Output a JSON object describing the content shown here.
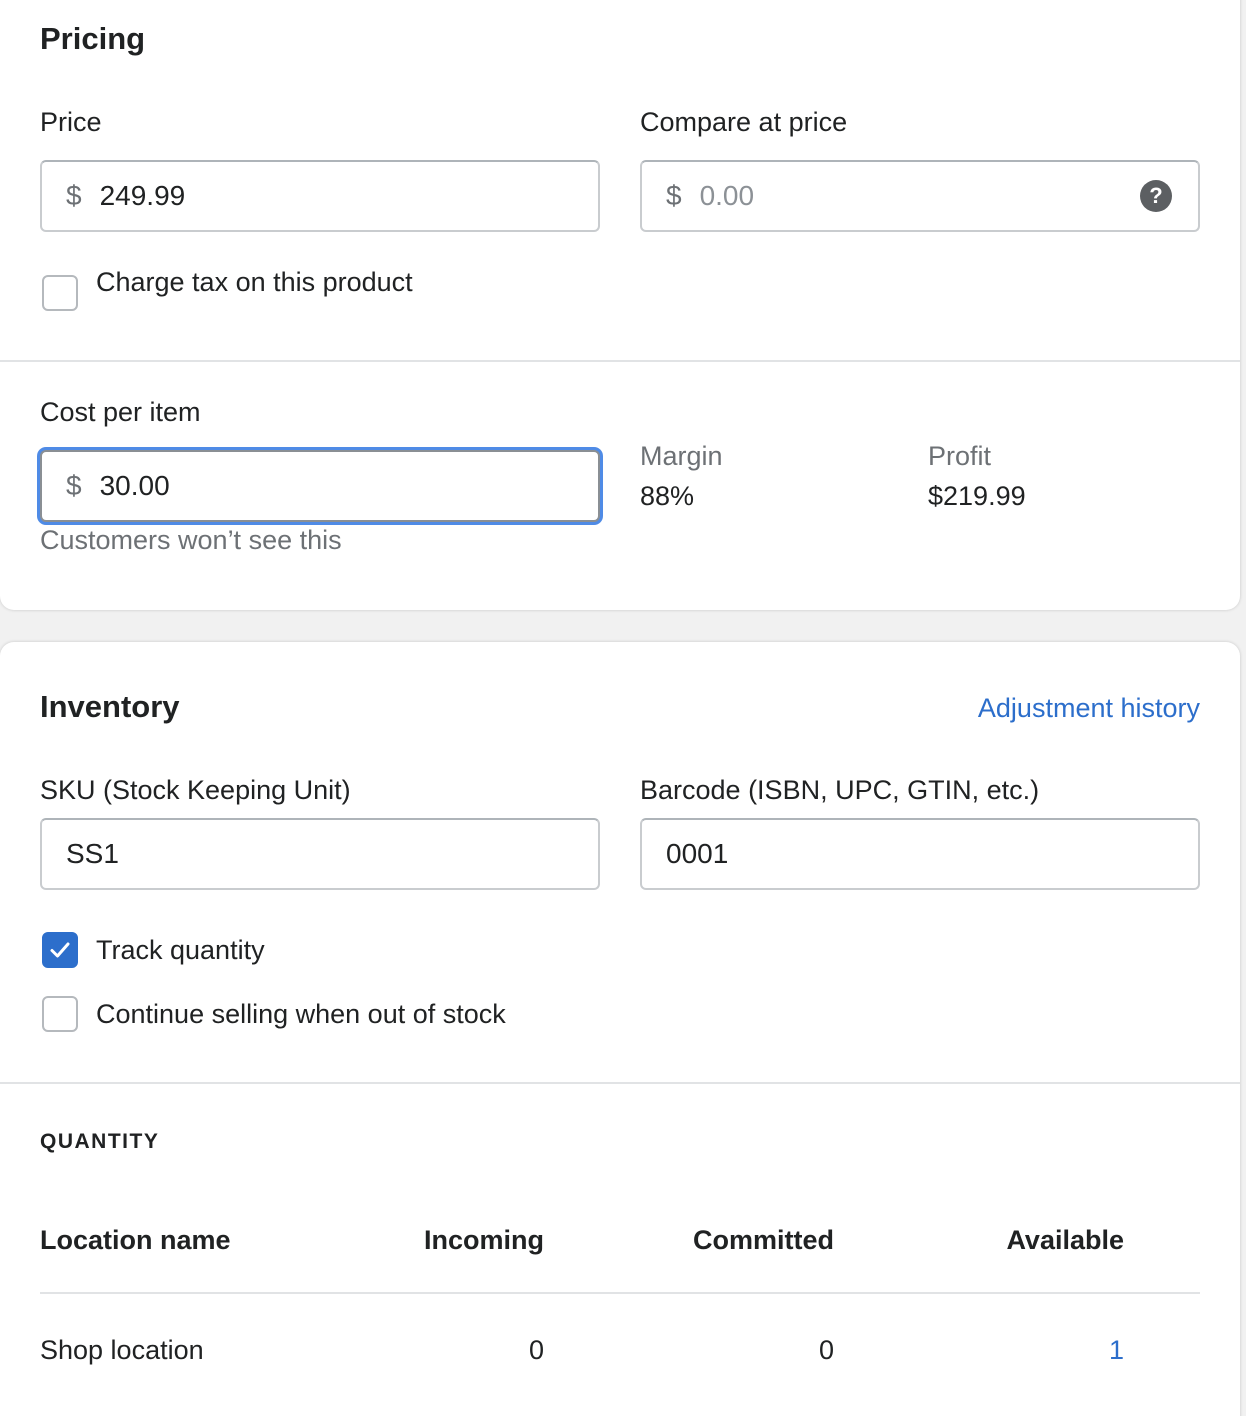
{
  "pricing": {
    "title": "Pricing",
    "price": {
      "label": "Price",
      "prefix": "$",
      "value": "249.99"
    },
    "compare_at_price": {
      "label": "Compare at price",
      "prefix": "$",
      "placeholder": "0.00",
      "help_icon": "question-circle-icon"
    },
    "charge_tax": {
      "label": "Charge tax on this product",
      "checked": false
    },
    "cost_per_item": {
      "label": "Cost per item",
      "prefix": "$",
      "value": "30.00",
      "help_text": "Customers won’t see this"
    },
    "margin": {
      "label": "Margin",
      "value": "88%"
    },
    "profit": {
      "label": "Profit",
      "value": "$219.99"
    }
  },
  "inventory": {
    "title": "Inventory",
    "adjustment_history_link": "Adjustment history",
    "sku": {
      "label": "SKU (Stock Keeping Unit)",
      "value": "SS1"
    },
    "barcode": {
      "label": "Barcode (ISBN, UPC, GTIN, etc.)",
      "value": "0001"
    },
    "track_quantity": {
      "label": "Track quantity",
      "checked": true
    },
    "continue_selling": {
      "label": "Continue selling when out of stock",
      "checked": false
    },
    "quantity": {
      "heading": "QUANTITY",
      "columns": [
        "Location name",
        "Incoming",
        "Committed",
        "Available"
      ],
      "rows": [
        {
          "location": "Shop location",
          "incoming": "0",
          "committed": "0",
          "available": "1"
        }
      ]
    }
  },
  "colors": {
    "accent": "#2c6ecb",
    "focus_ring": "#4f8be6",
    "text": "#202223",
    "muted": "#6d7175"
  }
}
